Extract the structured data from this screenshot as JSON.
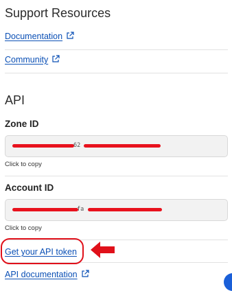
{
  "support": {
    "title": "Support Resources",
    "links": [
      {
        "label": "Documentation"
      },
      {
        "label": "Community"
      }
    ]
  },
  "api": {
    "title": "API",
    "zone": {
      "label": "Zone ID",
      "visible_fragment": "62",
      "hint": "Click to copy"
    },
    "account": {
      "label": "Account ID",
      "visible_fragment": "fa",
      "hint": "Click to copy"
    },
    "token_link": "Get your API token",
    "docs_link": "API documentation"
  },
  "annotation": {
    "color": "#e0101a"
  },
  "colors": {
    "link": "#0a4fb5",
    "redaction": "#e8121d",
    "accent": "#1a5fd8"
  }
}
